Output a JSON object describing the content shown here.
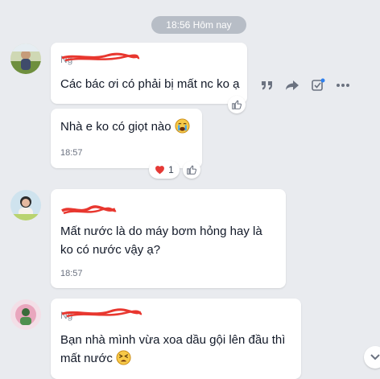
{
  "date_separator": "18:56 Hôm nay",
  "messages": [
    {
      "sender": "Ng",
      "text": "Các bác ơi có phải bị mất nc ko ạ"
    },
    {
      "text": "Nhà e ko có giọt nào",
      "time": "18:57",
      "reaction_count": "1",
      "reaction_icon": "heart-icon"
    },
    {
      "sender": "",
      "text_line1": "Mất nước là do máy bơm hỏng hay là",
      "text_line2": "ko có nước vậy ạ?",
      "time": "18:57"
    },
    {
      "sender": "Ng",
      "text_line1": "Bạn nhà mình vừa xoa dầu gội lên đầu thì",
      "text_line2": "mất nước"
    }
  ],
  "toolbar_icons": [
    "quote-icon",
    "forward-icon",
    "select-icon",
    "more-icon"
  ],
  "colors": {
    "background": "#e9ebef",
    "redaction": "#e8372f",
    "heart": "#e53935",
    "pill": "#b7bdc6"
  }
}
